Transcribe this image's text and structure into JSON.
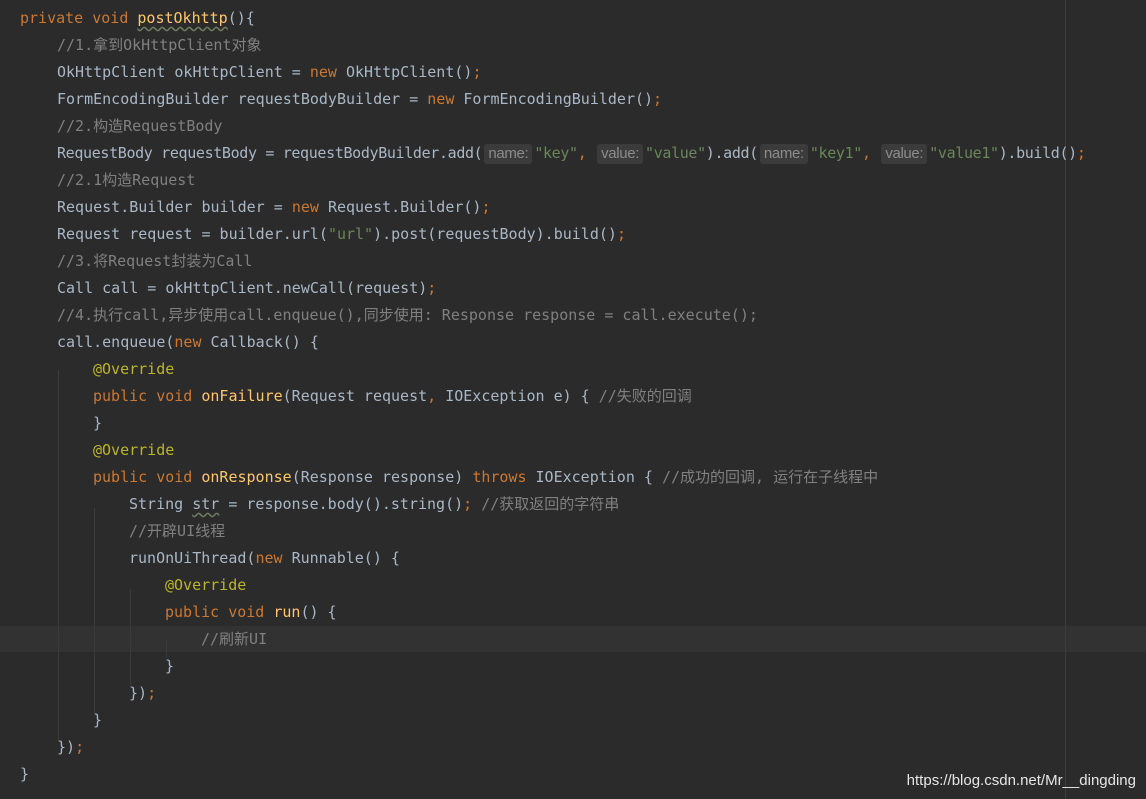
{
  "lines": {
    "l01": {
      "kw": "private void ",
      "fn": "postOkhttp",
      "rest": "(){"
    },
    "l02": {
      "comment": "//1.拿到OkHttpClient对象"
    },
    "l03": {
      "a": "OkHttpClient okHttpClient = ",
      "kw": "new ",
      "b": "OkHttpClient()",
      "semi": ";"
    },
    "l04": {
      "a": "FormEncodingBuilder requestBodyBuilder = ",
      "kw": "new ",
      "b": "FormEncodingBuilder()",
      "semi": ";"
    },
    "l05": {
      "comment": "//2.构造RequestBody"
    },
    "l06": {
      "a": "RequestBody requestBody = requestBodyBuilder.add(",
      "hint1": "name:",
      "s1": "\"key\"",
      "comma1": ", ",
      "hint2": "value:",
      "s2": "\"value\"",
      "b": ").add(",
      "hint3": "name:",
      "s3": "\"key1\"",
      "comma2": ", ",
      "hint4": "value:",
      "s4": "\"value1\"",
      "c": ").build()",
      "semi": ";"
    },
    "l07": {
      "comment": "//2.1构造Request"
    },
    "l08": {
      "a": "Request.Builder builder = ",
      "kw": "new ",
      "b": "Request.Builder()",
      "semi": ";"
    },
    "l09": {
      "a": "Request request = builder.url(",
      "s": "\"url\"",
      "b": ").post(requestBody).build()",
      "semi": ";"
    },
    "l10": {
      "comment": "//3.将Request封装为Call"
    },
    "l11": {
      "a": "Call call = okHttpClient.newCall(request)",
      "semi": ";"
    },
    "l12": {
      "comment": "//4.执行call,异步使用call.enqueue(),同步使用: Response response = call.execute();"
    },
    "l13": {
      "a": "call.enqueue(",
      "kw": "new ",
      "b": "Callback() {"
    },
    "l14": {
      "ann": "@Override"
    },
    "l15": {
      "kw": "public void ",
      "fn": "onFailure",
      "a": "(Request request",
      "comma": ", ",
      "b": "IOException e) { ",
      "comment": "//失败的回调"
    },
    "l16": {
      "a": "}"
    },
    "l17": {
      "ann": "@Override"
    },
    "l18": {
      "kw": "public void ",
      "fn": "onResponse",
      "a": "(Response response) ",
      "kw2": "throws ",
      "b": "IOException { ",
      "comment": "//成功的回调, 运行在子线程中"
    },
    "l19": {
      "a": "String ",
      "var": "str",
      "b": " = response.body().string()",
      "semi": "; ",
      "comment": "//获取返回的字符串"
    },
    "l20": {
      "comment": "//开辟UI线程"
    },
    "l21": {
      "a": "runOnUiThread(",
      "kw": "new ",
      "b": "Runnable() {"
    },
    "l22": {
      "ann": "@Override"
    },
    "l23": {
      "kw": "public void ",
      "fn": "run",
      "a": "() {"
    },
    "l24": {
      "comment": "//刷新UI"
    },
    "l25": {
      "a": "}"
    },
    "l26": {
      "a": "})",
      "semi": ";"
    },
    "l27": {
      "a": "}"
    },
    "l28": {
      "a": "})",
      "semi": ";"
    },
    "l29": {
      "a": "}"
    }
  },
  "watermark": "https://blog.csdn.net/Mr__dingding",
  "colors": {
    "background": "#2b2b2b",
    "keyword": "#cc7832",
    "function": "#ffc66d",
    "comment": "#808080",
    "string": "#6a8759",
    "annotation": "#bbb529",
    "text": "#a9b7c6"
  }
}
